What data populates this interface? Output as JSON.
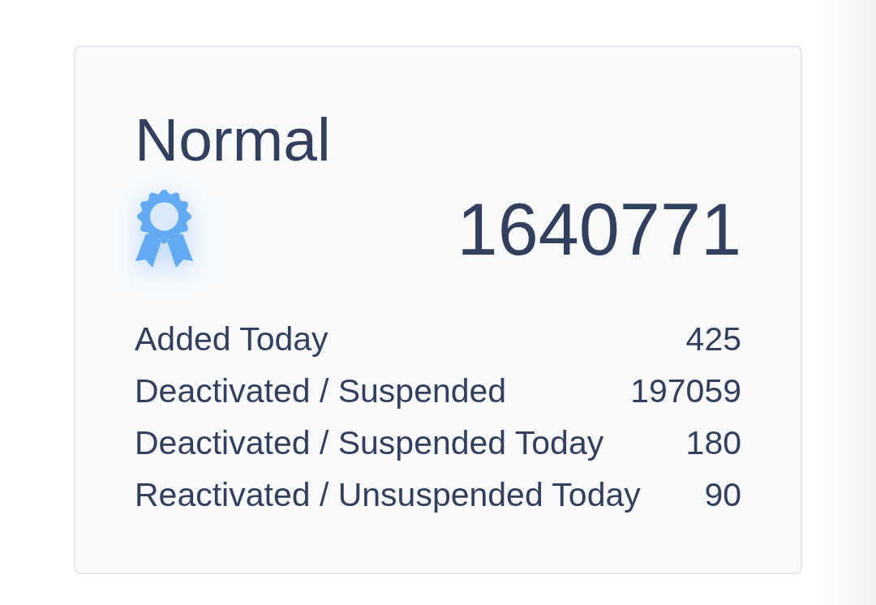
{
  "card": {
    "title": "Normal",
    "total": "1640771",
    "stats": [
      {
        "label": "Added Today",
        "value": "425"
      },
      {
        "label": "Deactivated / Suspended",
        "value": "197059"
      },
      {
        "label": "Deactivated / Suspended Today",
        "value": "180"
      },
      {
        "label": "Reactivated / Unsuspended Today",
        "value": "90"
      }
    ]
  }
}
